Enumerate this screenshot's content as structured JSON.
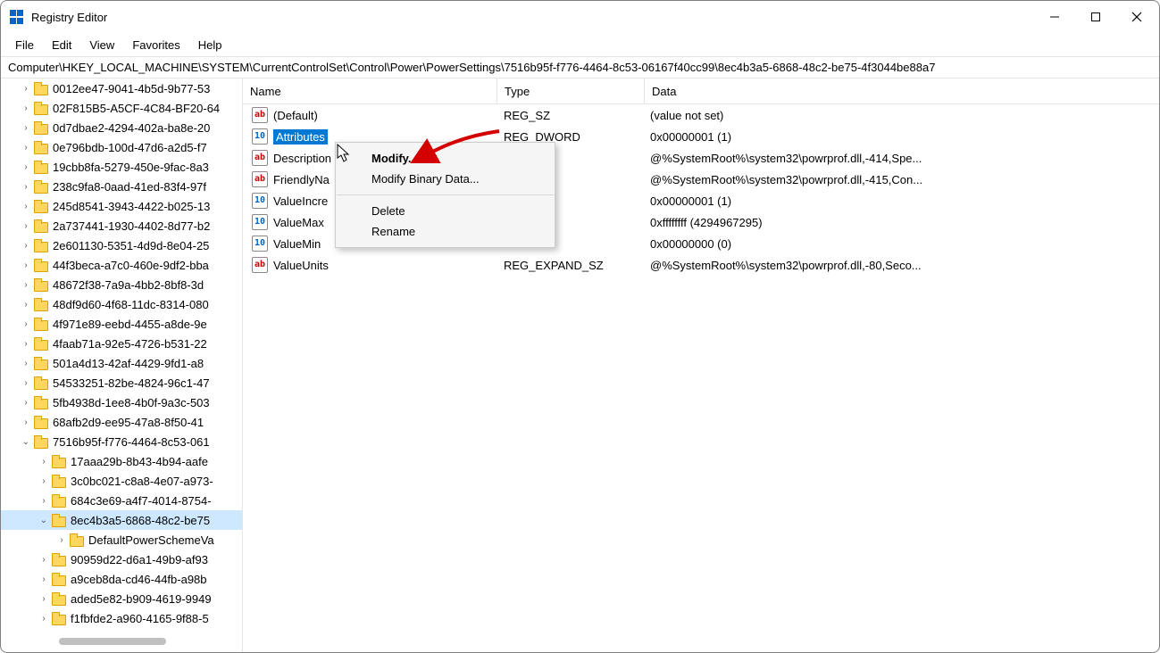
{
  "titlebar": {
    "title": "Registry Editor"
  },
  "win_buttons": {
    "min": "minimize",
    "max": "maximize",
    "close": "close"
  },
  "menu": {
    "file": "File",
    "edit": "Edit",
    "view": "View",
    "favorites": "Favorites",
    "help": "Help"
  },
  "address": "Computer\\HKEY_LOCAL_MACHINE\\SYSTEM\\CurrentControlSet\\Control\\Power\\PowerSettings\\7516b95f-f776-4464-8c53-06167f40cc99\\8ec4b3a5-6868-48c2-be75-4f3044be88a7",
  "tree": [
    {
      "d": 1,
      "t": ">",
      "l": "0012ee47-9041-4b5d-9b77-53"
    },
    {
      "d": 1,
      "t": ">",
      "l": "02F815B5-A5CF-4C84-BF20-64"
    },
    {
      "d": 1,
      "t": ">",
      "l": "0d7dbae2-4294-402a-ba8e-20"
    },
    {
      "d": 1,
      "t": ">",
      "l": "0e796bdb-100d-47d6-a2d5-f7"
    },
    {
      "d": 1,
      "t": ">",
      "l": "19cbb8fa-5279-450e-9fac-8a3"
    },
    {
      "d": 1,
      "t": ">",
      "l": "238c9fa8-0aad-41ed-83f4-97f"
    },
    {
      "d": 1,
      "t": ">",
      "l": "245d8541-3943-4422-b025-13"
    },
    {
      "d": 1,
      "t": ">",
      "l": "2a737441-1930-4402-8d77-b2"
    },
    {
      "d": 1,
      "t": ">",
      "l": "2e601130-5351-4d9d-8e04-25"
    },
    {
      "d": 1,
      "t": ">",
      "l": "44f3beca-a7c0-460e-9df2-bba"
    },
    {
      "d": 1,
      "t": ">",
      "l": "48672f38-7a9a-4bb2-8bf8-3d"
    },
    {
      "d": 1,
      "t": ">",
      "l": "48df9d60-4f68-11dc-8314-080"
    },
    {
      "d": 1,
      "t": ">",
      "l": "4f971e89-eebd-4455-a8de-9e"
    },
    {
      "d": 1,
      "t": ">",
      "l": "4faab71a-92e5-4726-b531-22"
    },
    {
      "d": 1,
      "t": ">",
      "l": "501a4d13-42af-4429-9fd1-a8"
    },
    {
      "d": 1,
      "t": ">",
      "l": "54533251-82be-4824-96c1-47"
    },
    {
      "d": 1,
      "t": ">",
      "l": "5fb4938d-1ee8-4b0f-9a3c-503"
    },
    {
      "d": 1,
      "t": ">",
      "l": "68afb2d9-ee95-47a8-8f50-41"
    },
    {
      "d": 1,
      "t": "v",
      "l": "7516b95f-f776-4464-8c53-061"
    },
    {
      "d": 2,
      "t": ">",
      "l": "17aaa29b-8b43-4b94-aafe"
    },
    {
      "d": 2,
      "t": ">",
      "l": "3c0bc021-c8a8-4e07-a973-"
    },
    {
      "d": 2,
      "t": ">",
      "l": "684c3e69-a4f7-4014-8754-"
    },
    {
      "d": 2,
      "t": "v",
      "l": "8ec4b3a5-6868-48c2-be75",
      "sel": true
    },
    {
      "d": 3,
      "t": ">",
      "l": "DefaultPowerSchemeVa"
    },
    {
      "d": 2,
      "t": ">",
      "l": "90959d22-d6a1-49b9-af93"
    },
    {
      "d": 2,
      "t": ">",
      "l": "a9ceb8da-cd46-44fb-a98b"
    },
    {
      "d": 2,
      "t": ">",
      "l": "aded5e82-b909-4619-9949"
    },
    {
      "d": 2,
      "t": ">",
      "l": "f1fbfde2-a960-4165-9f88-5"
    }
  ],
  "columns": {
    "name": "Name",
    "type": "Type",
    "data": "Data"
  },
  "values": [
    {
      "icon": "str",
      "name": "(Default)",
      "type": "REG_SZ",
      "data": "(value not set)",
      "sel": false
    },
    {
      "icon": "bin",
      "name": "Attributes",
      "type": "REG_DWORD",
      "data": "0x00000001 (1)",
      "sel": true
    },
    {
      "icon": "str",
      "name": "Description",
      "type": "REG_EXPAND_SZ",
      "data": "@%SystemRoot%\\system32\\powrprof.dll,-414,Spe...",
      "sel": false,
      "typeShown": "AND_SZ"
    },
    {
      "icon": "str",
      "name": "FriendlyName",
      "type": "REG_EXPAND_SZ",
      "data": "@%SystemRoot%\\system32\\powrprof.dll,-415,Con...",
      "sel": false,
      "nameShown": "FriendlyNa",
      "typeShown": "AND_SZ"
    },
    {
      "icon": "bin",
      "name": "ValueIncrement",
      "type": "REG_DWORD",
      "data": "0x00000001 (1)",
      "sel": false,
      "nameShown": "ValueIncre",
      "typeShown": "ORD"
    },
    {
      "icon": "bin",
      "name": "ValueMax",
      "type": "REG_DWORD",
      "data": "0xffffffff (4294967295)",
      "sel": false,
      "typeShown": "ORD"
    },
    {
      "icon": "bin",
      "name": "ValueMin",
      "type": "REG_DWORD",
      "data": "0x00000000 (0)",
      "sel": false,
      "typeShown": "ORD"
    },
    {
      "icon": "str",
      "name": "ValueUnits",
      "type": "REG_EXPAND_SZ",
      "data": "@%SystemRoot%\\system32\\powrprof.dll,-80,Seco...",
      "sel": false
    }
  ],
  "context_menu": {
    "modify": "Modify...",
    "modify_bin": "Modify Binary Data...",
    "delete": "Delete",
    "rename": "Rename"
  }
}
